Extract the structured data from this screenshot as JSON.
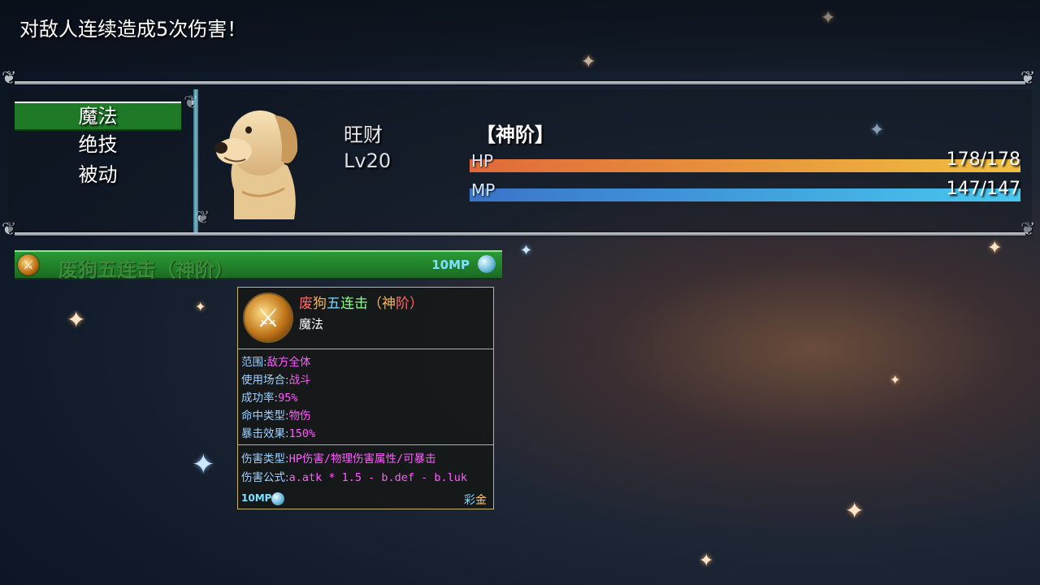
{
  "battle_log": {
    "message": "对敌人连续造成5次伤害！"
  },
  "command_menu": {
    "items": [
      {
        "label": "魔法",
        "selected": true
      },
      {
        "label": "绝技",
        "selected": false
      },
      {
        "label": "被动",
        "selected": false
      }
    ]
  },
  "actor": {
    "name": "旺财",
    "level": "Lv20",
    "tier": "【神阶】",
    "hp_label": "HP",
    "hp_value": "178/178",
    "hp_fraction": 1.0,
    "mp_label": "MP",
    "mp_value": "147/147",
    "mp_fraction": 1.0,
    "portrait_icon": "golden-retriever-portrait"
  },
  "skill_list": {
    "items": [
      {
        "name": "废狗五连击（神阶）",
        "cost": "10MP",
        "icon": "strike-icon",
        "cost_icon": "mp-orb-icon"
      }
    ]
  },
  "tooltip": {
    "title_chars": [
      "废",
      "狗",
      "五",
      "连",
      "击",
      "（",
      "神",
      "阶",
      "）"
    ],
    "title_colors": [
      "#ff6b6b",
      "#ffb347",
      "#7cd6ff",
      "#8cff8c",
      "#8cff8c",
      "#ffb347",
      "#ffb347",
      "#ff6b6b",
      "#ff6b6b"
    ],
    "type": "魔法",
    "props": [
      {
        "key": "范围:",
        "value": "敌方全体"
      },
      {
        "key": "使用场合:",
        "value": "战斗"
      },
      {
        "key": "成功率:",
        "value": "95%"
      },
      {
        "key": "命中类型:",
        "value": "物伤"
      },
      {
        "key": "暴击效果:",
        "value": "150%"
      }
    ],
    "damage_type_key": "伤害类型:",
    "damage_type_value": "HP伤害/物理伤害属性/可暴击",
    "formula_key": "伤害公式:",
    "formula_value": "a.atk * 1.5 - b.def - b.luk",
    "cost": "10MP",
    "rarity": "彩金"
  },
  "colors": {
    "hp_gradient": [
      "#e06a3a",
      "#f0c040"
    ],
    "mp_gradient": [
      "#3a74c8",
      "#48c8f0"
    ],
    "selected_bg": "#1f7a28",
    "tier_gold": "#ffffff",
    "rarity": [
      "#7cd6ff",
      "#ffd060"
    ]
  }
}
